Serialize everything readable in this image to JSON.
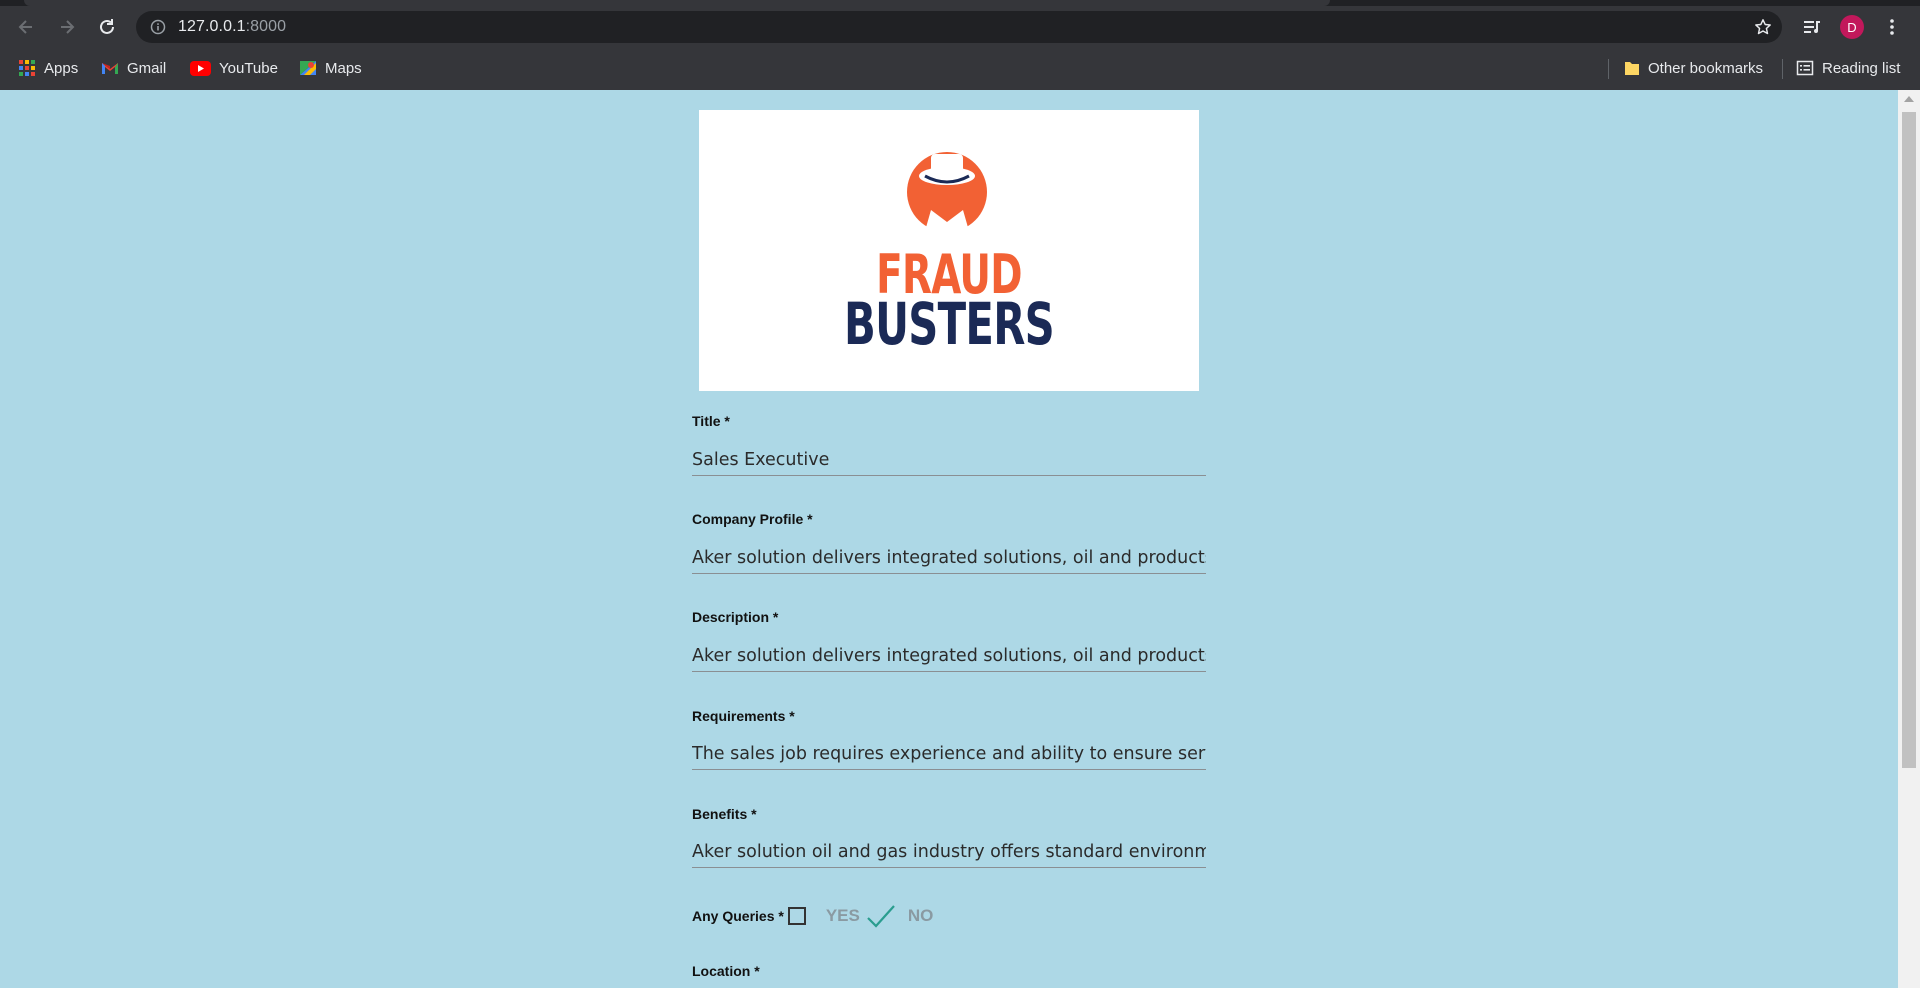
{
  "browser": {
    "url_host": "127.0.0.1",
    "url_port": ":8000",
    "profile_initial": "D",
    "bookmarks": [
      {
        "label": "Apps",
        "icon": "apps-grid-icon"
      },
      {
        "label": "Gmail",
        "icon": "gmail-icon"
      },
      {
        "label": "YouTube",
        "icon": "youtube-icon"
      },
      {
        "label": "Maps",
        "icon": "maps-icon"
      }
    ],
    "other_bookmarks": "Other bookmarks",
    "reading_list": "Reading list"
  },
  "logo": {
    "line1": "FRAUD",
    "line2": "BUSTERS",
    "colors": {
      "orange": "#f26134",
      "navy": "#1b2a56"
    }
  },
  "form": {
    "fields": [
      {
        "label": "Title *",
        "value": "Sales Executive"
      },
      {
        "label": "Company Profile *",
        "value": "Aker solution delivers integrated solutions, oil and products and services to the global energy industry"
      },
      {
        "label": "Description *",
        "value": "Aker solution delivers integrated solutions, oil and products and services to the global energy industry"
      },
      {
        "label": "Requirements *",
        "value": "The sales job requires experience and ability to ensure service quality"
      },
      {
        "label": "Benefits *",
        "value": "Aker solution oil and gas industry offers standard environment"
      }
    ],
    "queries": {
      "label": "Any Queries *",
      "yes": "YES",
      "no": "NO"
    },
    "location_label": "Location *"
  },
  "colors": {
    "page_bg": "#add8e6",
    "chrome_bg": "#35363a",
    "accent_check": "#2a9d8f"
  }
}
